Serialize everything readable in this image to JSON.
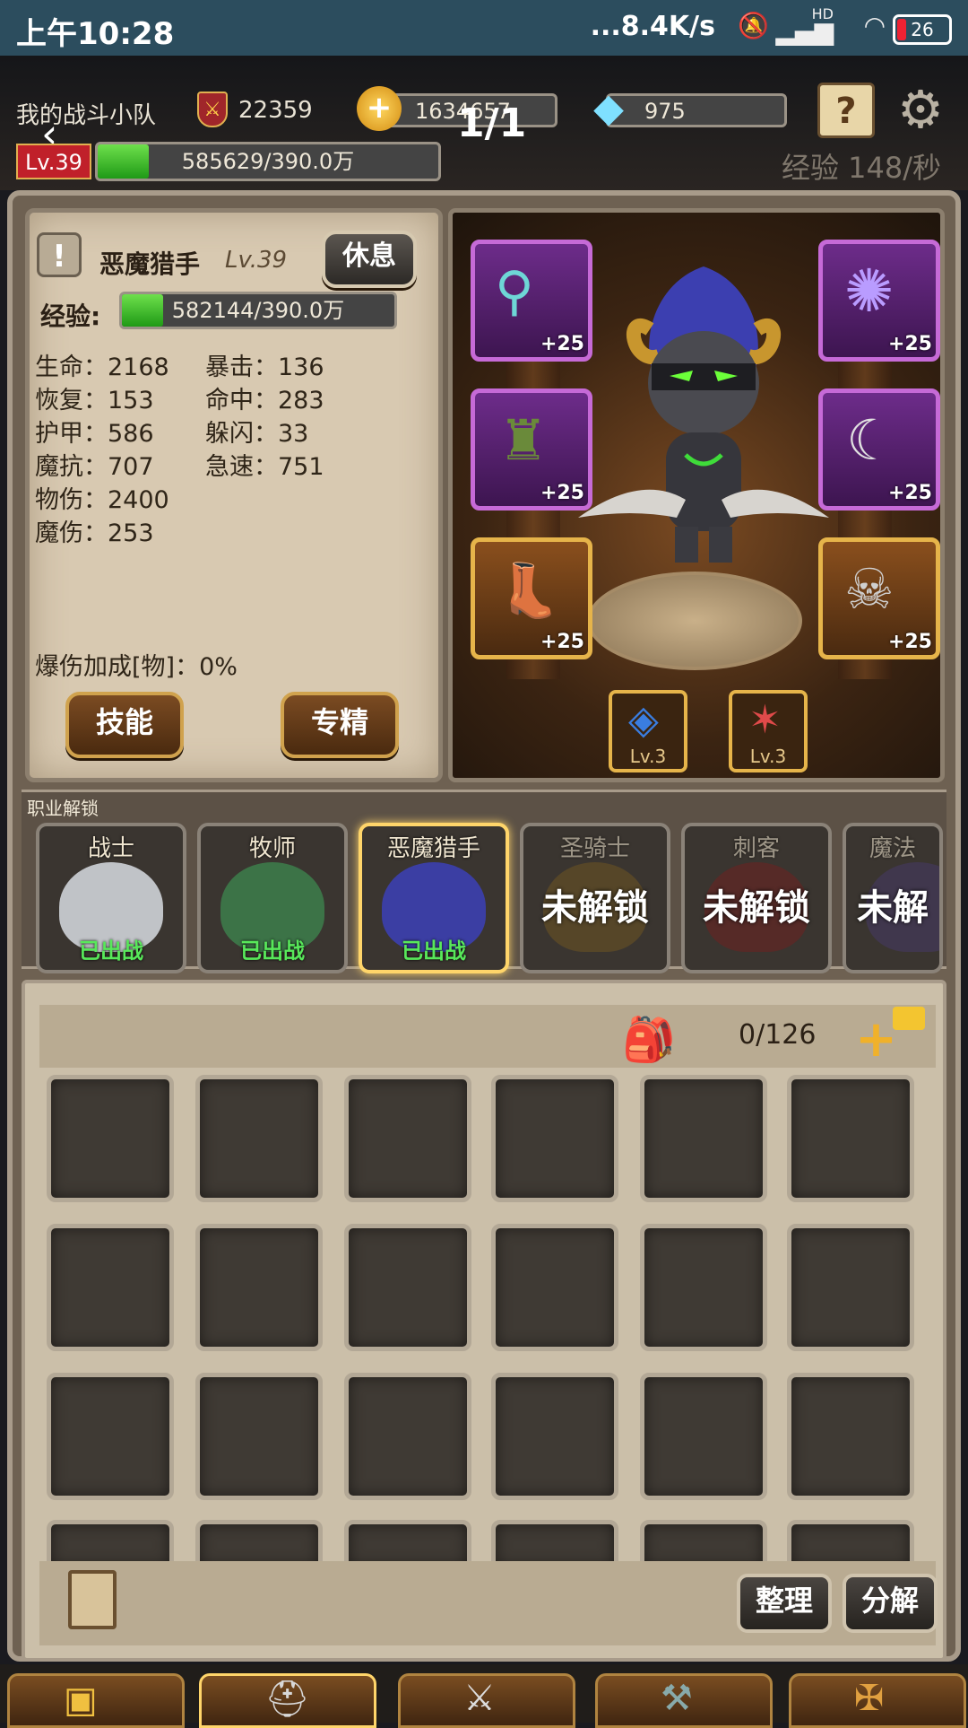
{
  "status_bar": {
    "time": "上午10:28",
    "network_speed": "...8.4K/s",
    "signal_label": "HD",
    "battery": "26"
  },
  "hud": {
    "team_name": "我的战斗小队",
    "power": "22359",
    "gold": "1634657",
    "diamonds": "975",
    "level": "Lv.39",
    "exp_text": "585629/390.0万",
    "exp_fraction": 0.15,
    "page_indicator": "1/1",
    "exp_rate": "经验 148/秒",
    "colors": {
      "exp_green": "#3fbf2a",
      "level_red": "#c0202a"
    }
  },
  "hero": {
    "name": "恶魔猎手",
    "level": "Lv.39",
    "rest_button": "休息",
    "exp_label": "经验:",
    "exp_text": "582144/390.0万",
    "exp_fraction": 0.15,
    "stats_left": [
      {
        "label": "生命",
        "value": "2168"
      },
      {
        "label": "恢复",
        "value": "153"
      },
      {
        "label": "护甲",
        "value": "586"
      },
      {
        "label": "魔抗",
        "value": "707"
      },
      {
        "label": "物伤",
        "value": "2400"
      },
      {
        "label": "魔伤",
        "value": "253"
      }
    ],
    "stats_right": [
      {
        "label": "暴击",
        "value": "136"
      },
      {
        "label": "命中",
        "value": "283"
      },
      {
        "label": "躲闪",
        "value": "33"
      },
      {
        "label": "急速",
        "value": "751"
      }
    ],
    "bonus_stat": {
      "label": "爆伤加成[物]",
      "value": "0%"
    },
    "skill_button": "技能",
    "spec_button": "专精",
    "equipment": [
      {
        "slot": "weapon-offhand",
        "icon": "feather-blade-icon",
        "level": "+25"
      },
      {
        "slot": "amulet",
        "icon": "purple-orb-icon",
        "level": "+25"
      },
      {
        "slot": "armor",
        "icon": "green-cloak-icon",
        "level": "+25"
      },
      {
        "slot": "weapon",
        "icon": "warglaive-icon",
        "level": "+25"
      },
      {
        "slot": "boots",
        "icon": "leather-boots-icon",
        "level": "+25"
      },
      {
        "slot": "ring",
        "icon": "skull-ring-icon",
        "level": "+25"
      }
    ],
    "gems": [
      {
        "icon": "blue-gem-badge-icon",
        "level": "Lv.3"
      },
      {
        "icon": "red-star-badge-icon",
        "level": "Lv.3"
      }
    ]
  },
  "class_unlock": {
    "title": "职业解锁",
    "classes": [
      {
        "name": "战士",
        "state": "已出战",
        "locked": false,
        "active": false
      },
      {
        "name": "牧师",
        "state": "已出战",
        "locked": false,
        "active": false
      },
      {
        "name": "恶魔猎手",
        "state": "已出战",
        "locked": false,
        "active": true
      },
      {
        "name": "圣骑士",
        "state": "未解锁",
        "locked": true,
        "active": false
      },
      {
        "name": "刺客",
        "state": "未解锁",
        "locked": true,
        "active": false
      },
      {
        "name": "魔法",
        "state": "未解",
        "locked": true,
        "active": false
      }
    ]
  },
  "inventory": {
    "capacity": "0/126",
    "sort_button": "整理",
    "decompose_button": "分解"
  }
}
